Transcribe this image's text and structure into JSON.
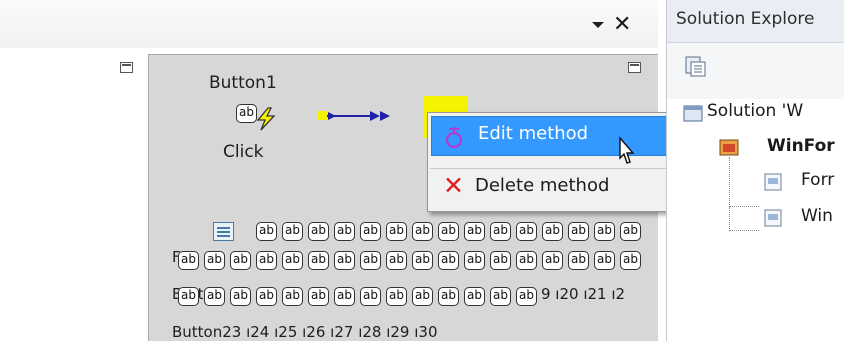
{
  "document": {
    "close_glyph": "✕",
    "dropdown_glyph": "▾"
  },
  "designer": {
    "button1": {
      "name": "Button1",
      "event": "Click",
      "widget_text": "ab"
    },
    "widget_text": "ab",
    "row_labels": {
      "form_prefix": "For",
      "button_prefix": "Butt",
      "trail": "9 ı20 ı21 ı2",
      "bottom_line": "Button23 ı24 ı25 ı26 ı27 ı28 ı29 ı30"
    },
    "icon_names": [
      "bolt-icon",
      "event-wire-icon",
      "method-node-icon"
    ]
  },
  "context_menu": {
    "items": [
      {
        "label": "Edit method",
        "icon": "edit-method-icon",
        "selected": true
      },
      {
        "label": "Delete method",
        "icon": "delete-x-icon",
        "selected": false
      }
    ],
    "colors": {
      "highlight": "#3399ff",
      "delete": "#e02020"
    }
  },
  "solution_explorer": {
    "title": "Solution Explore",
    "toolbar": {
      "icon": "properties-icon"
    },
    "tree": [
      {
        "label": "Solution 'W",
        "icon": "solution-icon",
        "bold": false
      },
      {
        "label": "WinFor",
        "icon": "project-icon",
        "bold": true
      },
      {
        "label": "Forr",
        "icon": "form-file-icon",
        "bold": false
      },
      {
        "label": "Win",
        "icon": "file-icon",
        "bold": false
      }
    ]
  }
}
